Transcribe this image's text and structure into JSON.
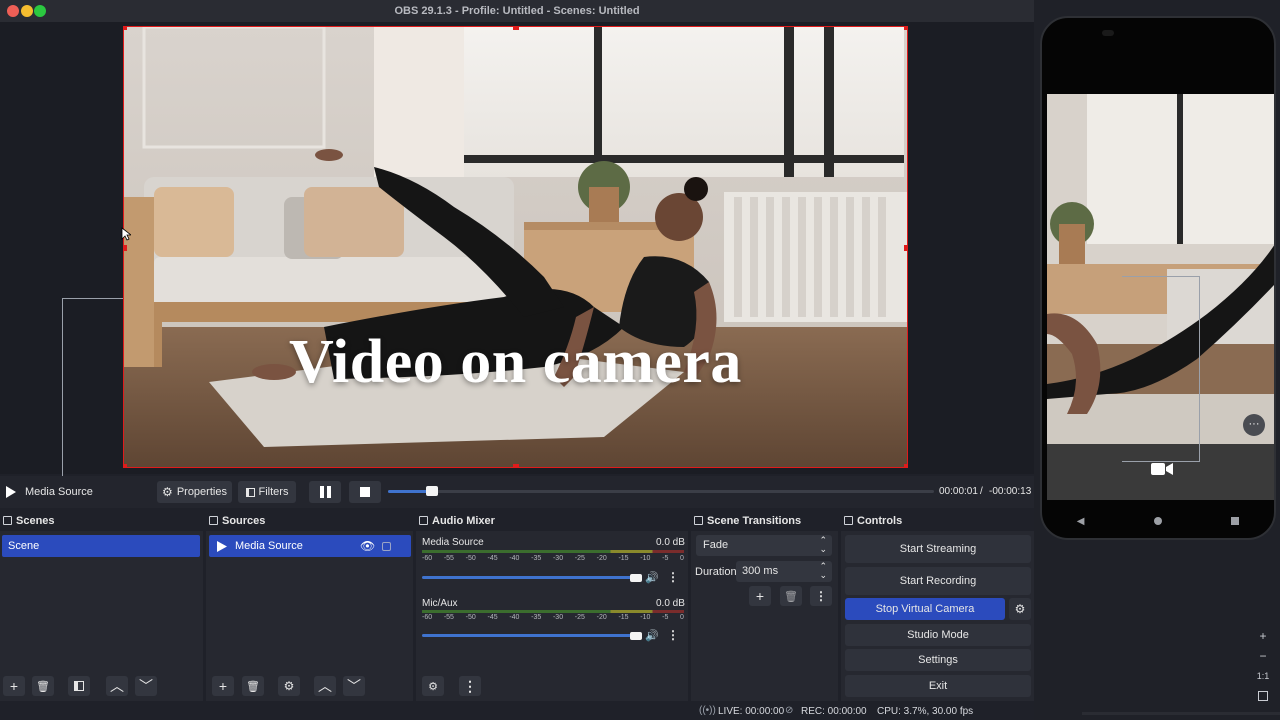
{
  "window": {
    "title": "OBS 29.1.3 - Profile: Untitled - Scenes: Untitled",
    "traffic_lights": [
      "#ee5f56",
      "#f5bd2f",
      "#2bc840"
    ]
  },
  "preview": {
    "overlay_text": "Video on camera"
  },
  "media_bar": {
    "source_name": "Media Source",
    "properties_label": "Properties",
    "filters_label": "Filters",
    "time_current": "00:00:01",
    "time_separator": "/",
    "time_remaining": "-00:00:13",
    "progress": 0.08
  },
  "scenes": {
    "title": "Scenes",
    "items": [
      "Scene"
    ]
  },
  "sources": {
    "title": "Sources",
    "items": [
      "Media Source"
    ]
  },
  "audio_mixer": {
    "title": "Audio Mixer",
    "channels": [
      {
        "name": "Media Source",
        "level": "0.0 dB",
        "volume": 1.0
      },
      {
        "name": "Mic/Aux",
        "level": "0.0 dB",
        "volume": 1.0
      }
    ],
    "scale": [
      "-60",
      "-55",
      "-50",
      "-45",
      "-40",
      "-35",
      "-30",
      "-25",
      "-20",
      "-15",
      "-10",
      "-5",
      "0"
    ]
  },
  "scene_transitions": {
    "title": "Scene Transitions",
    "transition": "Fade",
    "duration_label": "Duration",
    "duration_value": "300 ms"
  },
  "controls": {
    "title": "Controls",
    "start_streaming": "Start Streaming",
    "start_recording": "Start Recording",
    "stop_virtual_camera": "Stop Virtual Camera",
    "studio_mode": "Studio Mode",
    "settings": "Settings",
    "exit": "Exit"
  },
  "status": {
    "live": "LIVE: 00:00:00",
    "rec": "REC: 00:00:00",
    "cpu": "CPU: 3.7%, 30.00 fps"
  },
  "side_controls": [
    "+",
    "−",
    "1:1"
  ],
  "colors": {
    "accent": "#2b4bbd",
    "selection_border": "#e01b1b",
    "slider": "#3f73ce"
  }
}
